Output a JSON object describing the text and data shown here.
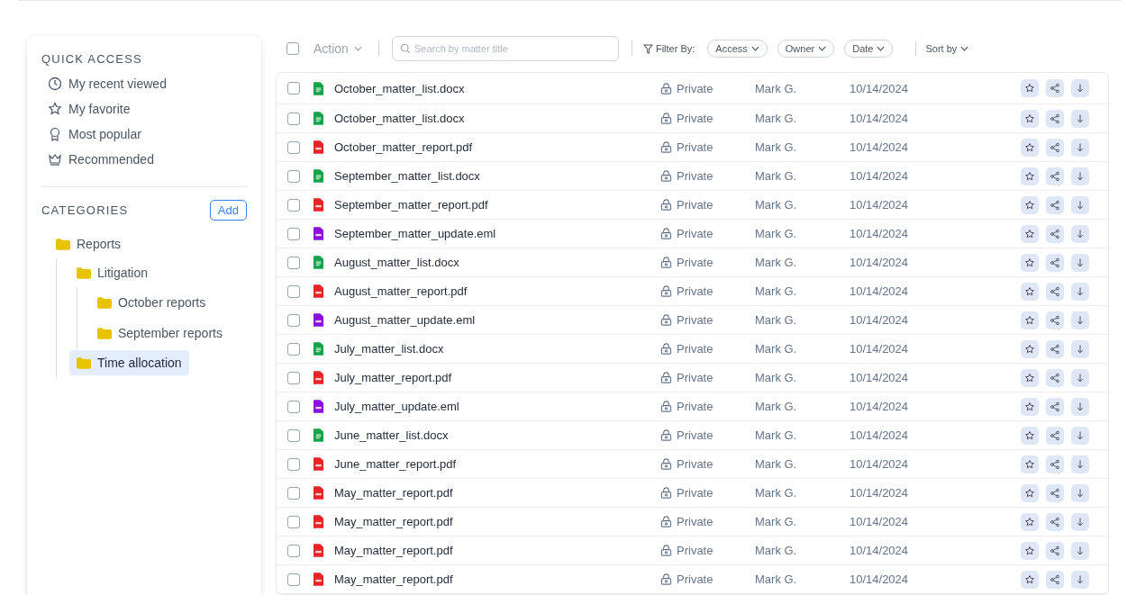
{
  "sidebar": {
    "quick_access_title": "QUICK ACCESS",
    "quick_access": [
      {
        "kind": "clock",
        "label": "My recent viewed"
      },
      {
        "kind": "star",
        "label": "My favorite"
      },
      {
        "kind": "award",
        "label": "Most popular"
      },
      {
        "kind": "crown",
        "label": "Recommended"
      }
    ],
    "categories_title": "CATEGORIES",
    "add_button": "Add",
    "categories": [
      {
        "label": "Reports",
        "selected": false,
        "children": [
          {
            "label": "Litigation",
            "selected": false,
            "children": [
              {
                "label": "October reports",
                "selected": false
              },
              {
                "label": "September reports",
                "selected": false
              }
            ]
          },
          {
            "label": "Time allocation",
            "selected": true
          }
        ]
      }
    ]
  },
  "toolbar": {
    "select_all_checked": false,
    "action": "Action",
    "search": {
      "placeholder": "Search by matter title"
    },
    "filter_label": "Filter By:",
    "filters": [
      "Access",
      "Owner",
      "Date"
    ],
    "sort": "Sort by"
  },
  "files": [
    {
      "kind": "doc",
      "name": "October_matter_list.docx",
      "access": "Private",
      "owner": "Mark G.",
      "date": "10/14/2024",
      "checked": false
    },
    {
      "kind": "doc",
      "name": "October_matter_list.docx",
      "access": "Private",
      "owner": "Mark G.",
      "date": "10/14/2024",
      "checked": false
    },
    {
      "kind": "pdf",
      "name": "October_matter_report.pdf",
      "access": "Private",
      "owner": "Mark G.",
      "date": "10/14/2024",
      "checked": false
    },
    {
      "kind": "doc",
      "name": "September_matter_list.docx",
      "access": "Private",
      "owner": "Mark G.",
      "date": "10/14/2024",
      "checked": false
    },
    {
      "kind": "pdf",
      "name": "September_matter_report.pdf",
      "access": "Private",
      "owner": "Mark G.",
      "date": "10/14/2024",
      "checked": false
    },
    {
      "kind": "eml",
      "name": "September_matter_update.eml",
      "access": "Private",
      "owner": "Mark G.",
      "date": "10/14/2024",
      "checked": false
    },
    {
      "kind": "doc",
      "name": "August_matter_list.docx",
      "access": "Private",
      "owner": "Mark G.",
      "date": "10/14/2024",
      "checked": false
    },
    {
      "kind": "pdf",
      "name": "August_matter_report.pdf",
      "access": "Private",
      "owner": "Mark G.",
      "date": "10/14/2024",
      "checked": false
    },
    {
      "kind": "eml",
      "name": "August_matter_update.eml",
      "access": "Private",
      "owner": "Mark G.",
      "date": "10/14/2024",
      "checked": false
    },
    {
      "kind": "doc",
      "name": "July_matter_list.docx",
      "access": "Private",
      "owner": "Mark G.",
      "date": "10/14/2024",
      "checked": false
    },
    {
      "kind": "pdf",
      "name": "July_matter_report.pdf",
      "access": "Private",
      "owner": "Mark G.",
      "date": "10/14/2024",
      "checked": false
    },
    {
      "kind": "eml",
      "name": "July_matter_update.eml",
      "access": "Private",
      "owner": "Mark G.",
      "date": "10/14/2024",
      "checked": false
    },
    {
      "kind": "doc",
      "name": "June_matter_list.docx",
      "access": "Private",
      "owner": "Mark G.",
      "date": "10/14/2024",
      "checked": false
    },
    {
      "kind": "pdf",
      "name": "June_matter_report.pdf",
      "access": "Private",
      "owner": "Mark G.",
      "date": "10/14/2024",
      "checked": false
    },
    {
      "kind": "pdf",
      "name": "May_matter_report.pdf",
      "access": "Private",
      "owner": "Mark G.",
      "date": "10/14/2024",
      "checked": false
    },
    {
      "kind": "pdf",
      "name": "May_matter_report.pdf",
      "access": "Private",
      "owner": "Mark G.",
      "date": "10/14/2024",
      "checked": false
    },
    {
      "kind": "pdf",
      "name": "May_matter_report.pdf",
      "access": "Private",
      "owner": "Mark G.",
      "date": "10/14/2024",
      "checked": false
    },
    {
      "kind": "pdf",
      "name": "May_matter_report.pdf",
      "access": "Private",
      "owner": "Mark G.",
      "date": "10/14/2024",
      "checked": false
    }
  ]
}
